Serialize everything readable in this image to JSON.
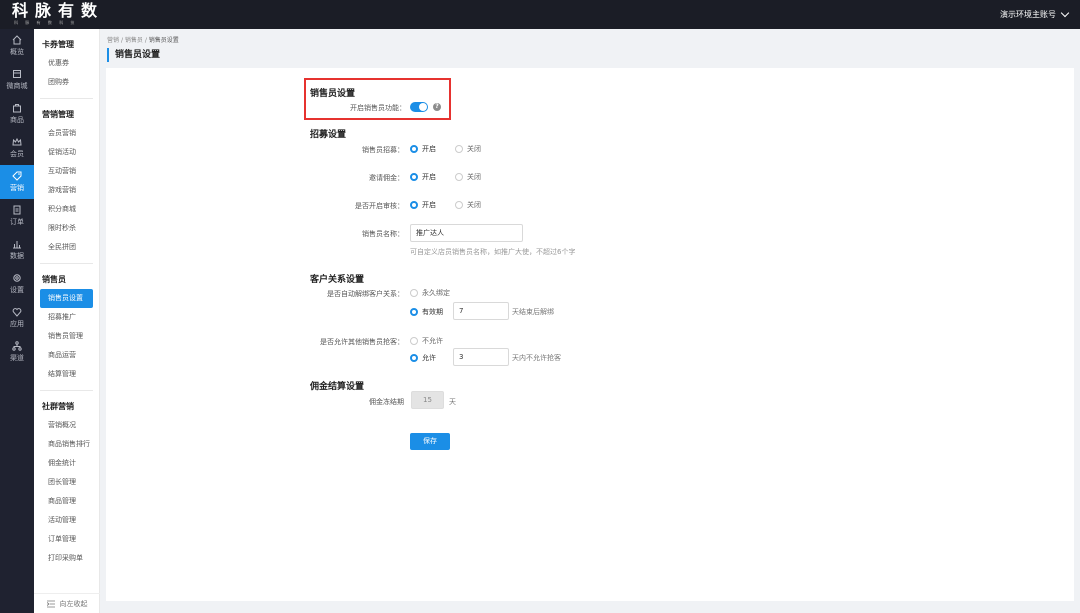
{
  "app": {
    "logo": "科脉有数",
    "logo_sub": "科 脉 有 数 科 技",
    "account": "演示环境主账号"
  },
  "rail": [
    {
      "label": "概览",
      "icon": "home-icon"
    },
    {
      "label": "微商城",
      "icon": "store-icon"
    },
    {
      "label": "商品",
      "icon": "bag-icon"
    },
    {
      "label": "会员",
      "icon": "crown-icon"
    },
    {
      "label": "营销",
      "icon": "tag-icon",
      "active": true
    },
    {
      "label": "订单",
      "icon": "document-icon"
    },
    {
      "label": "数据",
      "icon": "chart-icon"
    },
    {
      "label": "设置",
      "icon": "gear-icon"
    },
    {
      "label": "应用",
      "icon": "heart-icon"
    },
    {
      "label": "渠道",
      "icon": "channel-icon"
    }
  ],
  "sidebar": {
    "groups": [
      {
        "title": "卡券管理",
        "items": [
          "优惠券",
          "团购券"
        ]
      },
      {
        "title": "营销管理",
        "items": [
          "会员营销",
          "促销活动",
          "互动营销",
          "游戏营销",
          "积分商城",
          "限时秒杀",
          "全民拼团"
        ]
      },
      {
        "title": "销售员",
        "items": [
          "销售员设置",
          "招募推广",
          "销售员管理",
          "商品运营",
          "结算管理"
        ],
        "active": "销售员设置"
      },
      {
        "title": "社群营销",
        "items": [
          "营销概况",
          "商品销售排行",
          "佣金统计",
          "团长管理",
          "商品管理",
          "活动管理",
          "订单管理",
          "打印采购单"
        ]
      }
    ],
    "collapse_label": "向左收起"
  },
  "breadcrumb": {
    "items": [
      "营销",
      "销售员",
      "销售员设置"
    ]
  },
  "page_title": "销售员设置",
  "form": {
    "section1": {
      "title": "销售员设置",
      "toggle_label": "开启销售员功能：",
      "toggle_on": true
    },
    "section2": {
      "title": "招募设置",
      "recruit_label": "销售员招募：",
      "commission_label": "邀请佣金：",
      "review_label": "是否开启审核：",
      "on": "开启",
      "off": "关闭",
      "name_label": "销售员名称：",
      "name_value": "推广达人",
      "name_hint": "可自定义店员销售员名称，如推广大使，不超过6个字"
    },
    "section3": {
      "title": "客户关系设置",
      "unbind_label": "是否自动解绑客户关系：",
      "permanent": "永久绑定",
      "period": "有效期",
      "period_value": "7",
      "period_suffix": "天结束后解绑",
      "grab_label": "是否允许其他销售员抢客：",
      "disallow": "不允许",
      "allow": "允许",
      "allow_value": "3",
      "allow_suffix": "天内不允许抢客"
    },
    "section4": {
      "title": "佣金结算设置",
      "freeze_label": "佣金冻结期",
      "freeze_value": "15",
      "freeze_unit": "天"
    },
    "save_label": "保存"
  }
}
